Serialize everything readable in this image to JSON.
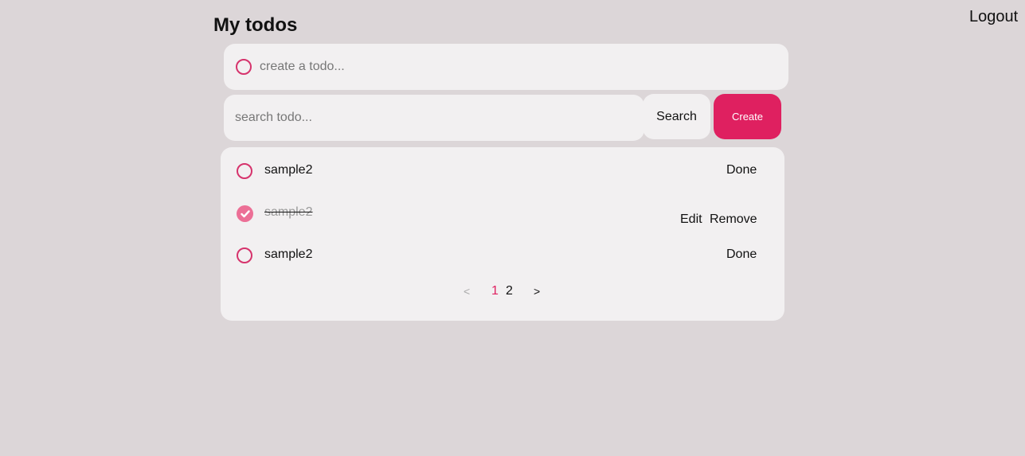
{
  "header": {
    "title": "My todos",
    "logout_label": "Logout"
  },
  "create_bar": {
    "placeholder": "create a todo...",
    "value": ""
  },
  "search": {
    "placeholder": "search todo...",
    "value": "",
    "search_label": "Search",
    "create_label": "Create"
  },
  "todos": [
    {
      "text": "sample2",
      "completed": false,
      "actions": [
        "Done"
      ]
    },
    {
      "text": "sample2",
      "completed": true,
      "actions": [
        "Edit",
        "Remove"
      ]
    },
    {
      "text": "sample2",
      "completed": false,
      "actions": [
        "Done"
      ]
    }
  ],
  "pagination": {
    "prev": "<",
    "pages": [
      "1",
      "2"
    ],
    "current_page": "1",
    "next": ">"
  },
  "colors": {
    "accent": "#df2060",
    "checked_fill": "#ec6f96",
    "background": "#dcd6d8",
    "card": "#f2f0f1"
  }
}
